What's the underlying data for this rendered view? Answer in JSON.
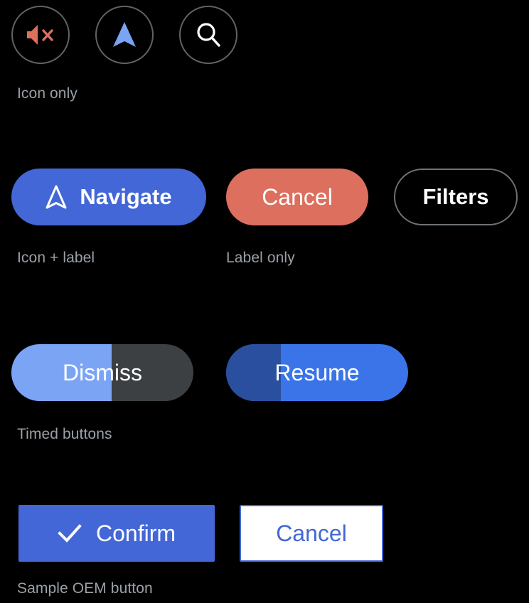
{
  "theme": {
    "background": "#000000",
    "label_color": "#9aa0a6",
    "accent_blue": "#4367d6",
    "bright_blue": "#3b74e8",
    "light_blue": "#7ba4f5",
    "dark_blue": "#2a4f9e",
    "salmon": "#dd6f5e",
    "outline_gray": "#5f6368",
    "track_gray": "#3c4043",
    "white": "#ffffff"
  },
  "sections": {
    "icon_only": {
      "label": "Icon only",
      "buttons": [
        {
          "icon": "volume-mute-icon",
          "color": "#dd6f5e"
        },
        {
          "icon": "navigation-arrow-icon",
          "color": "#7ba4f5"
        },
        {
          "icon": "search-icon",
          "color": "#ffffff"
        }
      ]
    },
    "icon_label": {
      "label": "Icon + label",
      "button": {
        "text": "Navigate",
        "icon": "navigation-arrow-outline-icon",
        "background": "#4367d6",
        "color": "#ffffff"
      }
    },
    "label_only": {
      "label": "Label only",
      "buttons": [
        {
          "text": "Cancel",
          "background": "#dd6f5e",
          "color": "#ffffff",
          "style": "filled"
        },
        {
          "text": "Filters",
          "background": "#000000",
          "color": "#ffffff",
          "style": "outlined"
        }
      ]
    },
    "timed": {
      "label": "Timed buttons",
      "buttons": [
        {
          "text": "Dismiss",
          "progress_percent": 55,
          "fill_color": "#7ba4f5",
          "track_color": "#3c4043"
        },
        {
          "text": "Resume",
          "progress_percent": 30,
          "fill_color": "#2a4f9e",
          "track_color": "#3b74e8"
        }
      ]
    },
    "oem": {
      "label": "Sample OEM button",
      "buttons": [
        {
          "text": "Confirm",
          "icon": "check-icon",
          "background": "#4367d6",
          "color": "#ffffff",
          "style": "filled"
        },
        {
          "text": "Cancel",
          "background": "#ffffff",
          "color": "#4367d6",
          "style": "outlined"
        }
      ]
    }
  }
}
